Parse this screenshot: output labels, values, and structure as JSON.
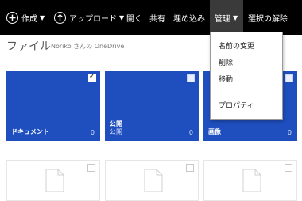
{
  "toolbar": {
    "create_label": "作成",
    "upload_label": "アップロード",
    "open_label": "開く",
    "share_label": "共有",
    "embed_label": "埋め込み",
    "manage_label": "管理",
    "deselect_label": "選択の解除"
  },
  "header": {
    "title": "ファイル",
    "owner": "Noriko さんの OneDrive"
  },
  "tiles": [
    {
      "name": "ドキュメント",
      "subtitle": "",
      "count": "0",
      "checked": true
    },
    {
      "name": "公開",
      "subtitle": "公開",
      "count": "0",
      "checked": false
    },
    {
      "name": "画像",
      "subtitle": "",
      "count": "0",
      "checked": false
    }
  ],
  "manage_menu": {
    "items": [
      "名前の変更",
      "削除",
      "移動",
      "プロパティ"
    ]
  },
  "colors": {
    "bar": "#000000",
    "tile": "#1f4fbf"
  }
}
